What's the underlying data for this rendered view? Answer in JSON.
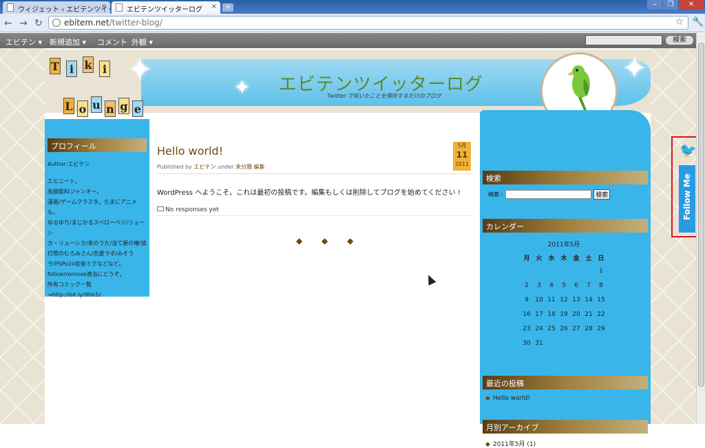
{
  "browser": {
    "tabs": [
      {
        "label": "ウィジェット ‹ エビテンツイッタ...",
        "active": false
      },
      {
        "label": "エビテンツイッターログ",
        "active": true
      }
    ],
    "close_glyph": "×",
    "new_tab_glyph": "+",
    "url_host": "ebitem.net",
    "url_path": "/twitter-blog/",
    "window_buttons": {
      "minimize": "‒",
      "maximize": "❐",
      "close": "✕"
    },
    "nav": {
      "back": "←",
      "forward": "→",
      "reload": "↻"
    },
    "star_glyph": "☆",
    "wrench_glyph": "🔧"
  },
  "adminbar": {
    "menus": [
      "エビテン ▾",
      "新規追加 ▾",
      "コメント",
      "外観 ▾"
    ],
    "search_button": "検索"
  },
  "header": {
    "site_title": "エビテンツイッターログ",
    "site_description": "Twitter で呟いたことを保存するだけのブログ",
    "logo_letters_top": [
      "T",
      "i",
      "k",
      "i"
    ],
    "logo_letters_bottom": [
      "L",
      "o",
      "u",
      "n",
      "g",
      "e"
    ]
  },
  "left_sidebar": {
    "heading": "プロフィール",
    "author": "Author:エビテン",
    "bio_lines": [
      "エヒニート。",
      "炭酸飲料ジャンキー。",
      "漫画/ゲームクラスタ。たまにアニメも。",
      "ゆるゆり/まじかるスペローベリ/リューシ",
      "カ・リューシカ/未のうた/当て屋の椿/波",
      "打際のむろみさん/恋愛ラボ/みそう",
      "ラ/PSPo2i/初音ミクなどなど。",
      "follow/remove適当にどうぞ。",
      "所有コミック一覧",
      "→http://bit.ly/9tio1c"
    ]
  },
  "post": {
    "title": "Hello world!",
    "meta_prefix": "Published by",
    "author": "エビテン",
    "meta_under": "under",
    "category": "未分類",
    "edit": "編集",
    "date_month": "5月",
    "date_day": "11",
    "date_year": "2011",
    "body": "WordPress へようこそ。これは最初の投稿です。編集もしくは削除してブログを始めてください !",
    "responses": "No responses yet",
    "separator": "◆ ◆ ◆"
  },
  "right_sidebar": {
    "search_heading": "検索",
    "search_label": "検索 :",
    "search_button": "検索",
    "calendar_heading": "カレンダー",
    "calendar_caption": "2011年5月",
    "weekdays": [
      "月",
      "火",
      "水",
      "木",
      "金",
      "土",
      "日"
    ],
    "weeks": [
      [
        "",
        "",
        "",
        "",
        "",
        "",
        "1"
      ],
      [
        "2",
        "3",
        "4",
        "5",
        "6",
        "7",
        "8"
      ],
      [
        "9",
        "10",
        "11",
        "12",
        "13",
        "14",
        "15"
      ],
      [
        "16",
        "17",
        "18",
        "19",
        "20",
        "21",
        "22"
      ],
      [
        "23",
        "24",
        "25",
        "26",
        "27",
        "28",
        "29"
      ],
      [
        "30",
        "31",
        "",
        "",
        "",
        "",
        ""
      ]
    ],
    "recent_heading": "最近の投稿",
    "recent_items": [
      "Hello world!"
    ],
    "archive_heading": "月別アーカイブ",
    "archive_items": [
      "2011年5月 (1)"
    ]
  },
  "follow_widget": {
    "label": "Follow Me",
    "bird_glyph": "🐦",
    "highlight_color": "#d6181c"
  },
  "colors": {
    "sidebar_blue": "#39b5ea",
    "heading_brown": "#5a3d14",
    "title_green": "#5a8a2a"
  }
}
